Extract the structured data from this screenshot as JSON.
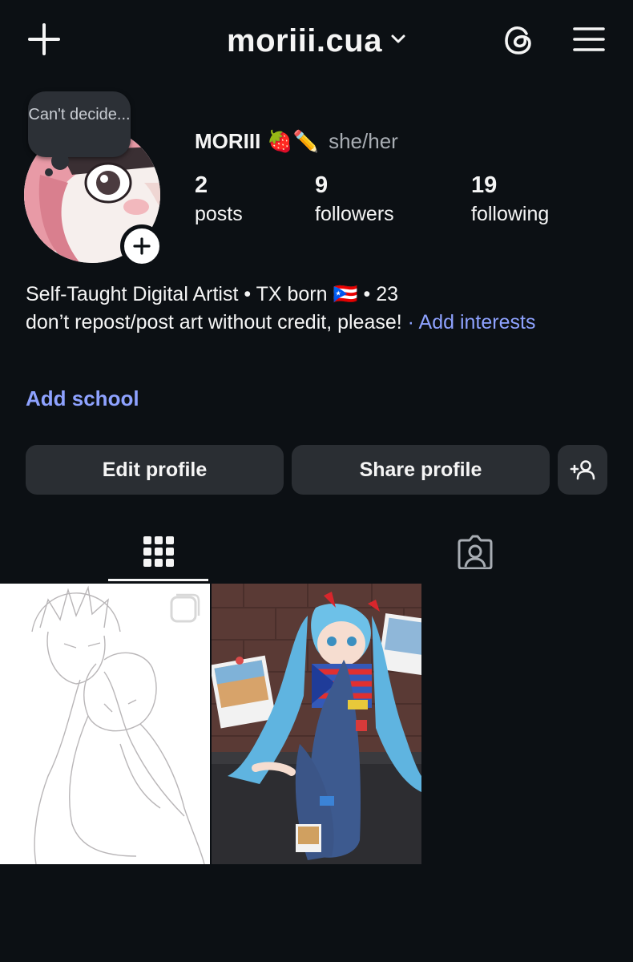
{
  "header": {
    "username": "moriii.cua",
    "add_icon": "plus-icon",
    "threads_icon": "threads-icon",
    "menu_icon": "hamburger-menu-icon"
  },
  "profile": {
    "note": "Can't decide...",
    "display_name": "MORIII",
    "name_emojis": "🍓✏️",
    "pronouns": "she/her",
    "stats": [
      {
        "count": "2",
        "label": "posts"
      },
      {
        "count": "9",
        "label": "followers"
      },
      {
        "count": "19",
        "label": "following"
      }
    ]
  },
  "bio": {
    "line1": "Self-Taught Digital Artist • TX born 🇵🇷 • 23",
    "line2": "don’t repost/post art without credit, please!",
    "add_interests_prefix": " · ",
    "add_interests": "Add interests",
    "add_school": "Add school"
  },
  "actions": {
    "edit_profile": "Edit profile",
    "share_profile": "Share profile",
    "discover_icon": "add-person-icon"
  },
  "tabs": [
    {
      "name": "grid",
      "icon": "grid-icon",
      "active": true
    },
    {
      "name": "tagged",
      "icon": "tagged-person-icon",
      "active": false
    }
  ],
  "colors": {
    "background": "#0c1014",
    "button": "#2a2e33",
    "link": "#8ea2ff"
  }
}
